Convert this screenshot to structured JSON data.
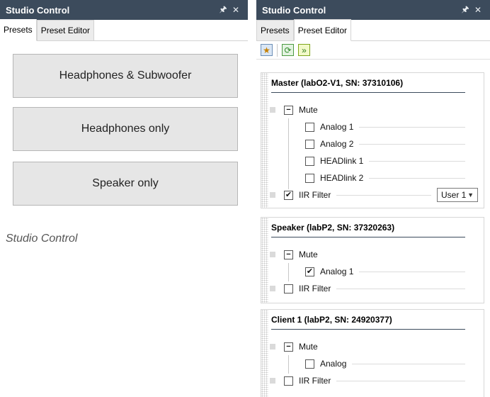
{
  "left": {
    "title": "Studio Control",
    "pin_icon": "pin-icon",
    "close_icon": "close-icon",
    "tabs": [
      {
        "label": "Presets",
        "active": true
      },
      {
        "label": "Preset Editor",
        "active": false
      }
    ],
    "presets": [
      {
        "label": "Headphones & Subwoofer"
      },
      {
        "label": "Headphones only"
      },
      {
        "label": "Speaker only"
      }
    ],
    "caption": "Studio Control"
  },
  "right": {
    "title": "Studio Control",
    "tabs": [
      {
        "label": "Presets",
        "active": false
      },
      {
        "label": "Preset Editor",
        "active": true
      }
    ],
    "toolbar": [
      "new-preset-icon",
      "refresh-icon",
      "apply-icon"
    ],
    "devices": [
      {
        "name": "Master  (labO2-V1, SN: 37310106)",
        "mute_label": "Mute",
        "items": [
          {
            "label": "Analog 1",
            "checked": false
          },
          {
            "label": "Analog 2",
            "checked": false
          },
          {
            "label": "HEADlink 1",
            "checked": false
          },
          {
            "label": "HEADlink 2",
            "checked": false
          }
        ],
        "iir_label": "IIR Filter",
        "iir_checked": true,
        "iir_select": "User 1"
      },
      {
        "name": "Speaker (labP2, SN: 37320263)",
        "mute_label": "Mute",
        "items": [
          {
            "label": "Analog 1",
            "checked": true
          }
        ],
        "iir_label": "IIR Filter",
        "iir_checked": false
      },
      {
        "name": "Client 1 (labP2, SN: 24920377)",
        "mute_label": "Mute",
        "items": [
          {
            "label": "Analog",
            "checked": false
          }
        ],
        "iir_label": "IIR Filter",
        "iir_checked": false
      }
    ]
  }
}
